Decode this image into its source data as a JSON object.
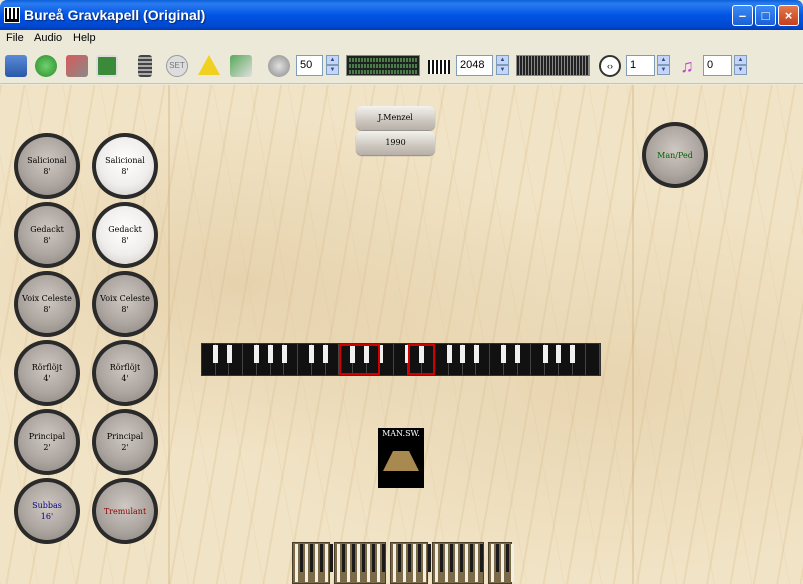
{
  "window": {
    "title": "Bureå Gravkapell (Original)"
  },
  "menu": [
    "File",
    "Audio",
    "Help"
  ],
  "toolbar": {
    "icons": [
      "open-folder-icon",
      "reload-icon",
      "audio-settings-icon",
      "organ-settings-icon",
      "memory-icon",
      "set-icon",
      "warning-icon",
      "midi-icon",
      "volume-icon",
      "keyboard-icon",
      "transpose-icon",
      "tuning-icon"
    ],
    "volume": "50",
    "polyphony": "2048",
    "transpose": "1",
    "tuning": "0"
  },
  "stops_left": [
    {
      "label1": "Salicional",
      "label2": "8'",
      "on": false,
      "color": "#000000"
    },
    {
      "label1": "Gedackt",
      "label2": "8'",
      "on": false,
      "color": "#000000"
    },
    {
      "label1": "Voix Celeste",
      "label2": "8'",
      "on": false,
      "color": "#000000"
    },
    {
      "label1": "Rörflöjt",
      "label2": "4'",
      "on": false,
      "color": "#000000"
    },
    {
      "label1": "Principal",
      "label2": "2'",
      "on": false,
      "color": "#000000"
    },
    {
      "label1": "Subbas",
      "label2": "16'",
      "on": false,
      "color": "#000080"
    }
  ],
  "stops_right": [
    {
      "label1": "Salicional",
      "label2": "8'",
      "on": true,
      "color": "#000000"
    },
    {
      "label1": "Gedackt",
      "label2": "8'",
      "on": true,
      "color": "#000000"
    },
    {
      "label1": "Voix Celeste",
      "label2": "8'",
      "on": false,
      "color": "#000000"
    },
    {
      "label1": "Rörflöjt",
      "label2": "4'",
      "on": false,
      "color": "#000000"
    },
    {
      "label1": "Principal",
      "label2": "2'",
      "on": false,
      "color": "#000000"
    },
    {
      "label1": "Tremulant",
      "label2": "",
      "on": false,
      "color": "#8b0000"
    }
  ],
  "coupler": {
    "label": "Man/Ped",
    "color": "#006400"
  },
  "builder": "J.Menzel",
  "year": "1990",
  "swell_label": "MAN.SW."
}
